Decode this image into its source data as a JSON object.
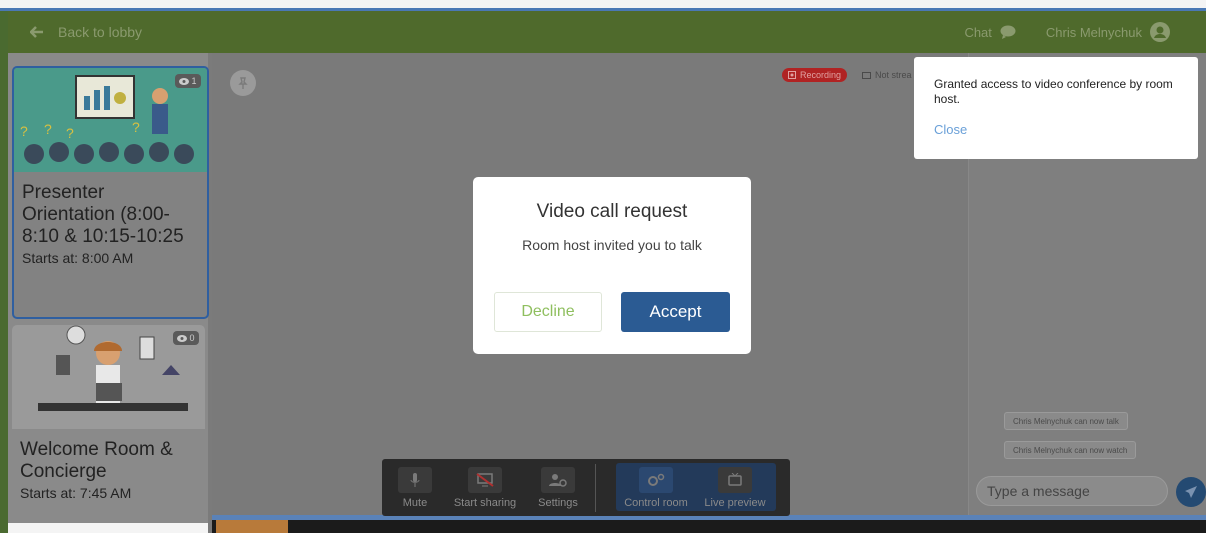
{
  "header": {
    "back_label": "Back to lobby",
    "chat_label": "Chat",
    "user_name": "Chris Melnychuk"
  },
  "sidebar": {
    "rooms": [
      {
        "viewers": "1",
        "title": "Presenter Orientation (8:00-8:10 & 10:15-10:25",
        "starts": "Starts at: 8:00 AM"
      },
      {
        "viewers": "0",
        "title": "Welcome Room & Concierge",
        "starts": "Starts at: 7:45 AM"
      }
    ]
  },
  "stage": {
    "recording_label": "Recording",
    "not_streaming_label": "Not strea"
  },
  "modal": {
    "title": "Video call request",
    "message": "Room host invited you to talk",
    "decline_label": "Decline",
    "accept_label": "Accept"
  },
  "toast": {
    "message": "Granted access to video conference by room host.",
    "close_label": "Close"
  },
  "chat": {
    "system_messages": [
      "Chris Melnychuk can now talk",
      "Chris Melnychuk can now watch"
    ],
    "placeholder": "Type a message"
  },
  "toolbar": {
    "mute_label": "Mute",
    "share_label": "Start sharing",
    "settings_label": "Settings",
    "control_label": "Control room",
    "preview_label": "Live preview"
  },
  "colors": {
    "header_bg": "#4f6a2c",
    "accent_blue": "#2b5b93",
    "decline_green": "#8fbf5f",
    "recording_red": "#b02323",
    "link_blue": "#6aa0d8"
  }
}
